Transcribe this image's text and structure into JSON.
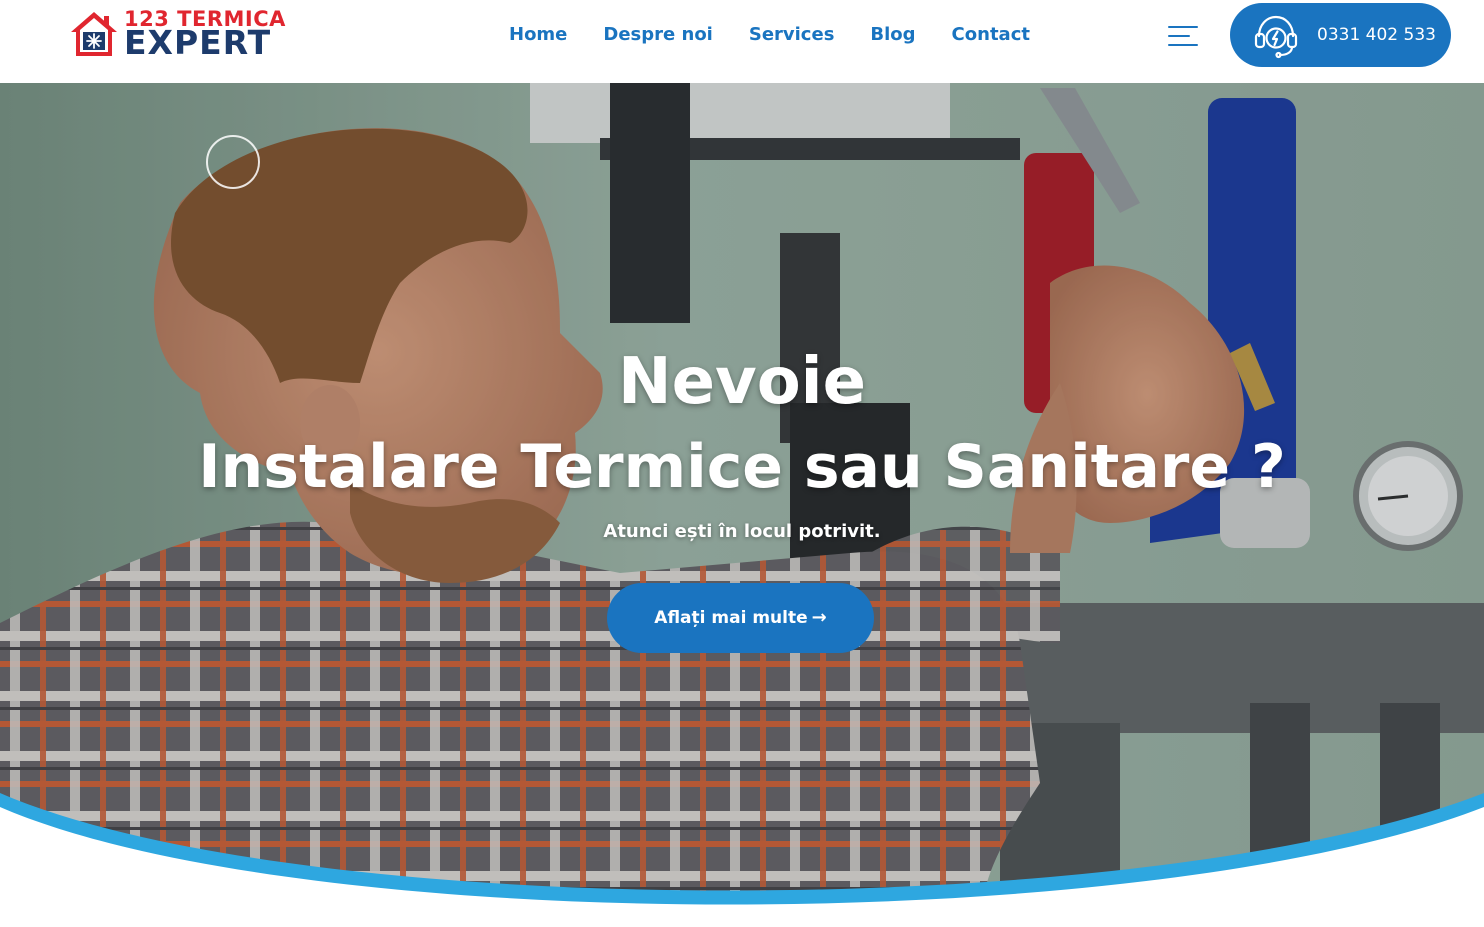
{
  "brand": {
    "line1": "123 TERMICA",
    "line2": "EXPERT",
    "colors": {
      "red": "#e0262f",
      "navy": "#1d3b6c",
      "accent": "#1a74c0"
    }
  },
  "nav": {
    "items": [
      {
        "label": "Home"
      },
      {
        "label": "Despre noi"
      },
      {
        "label": "Services"
      },
      {
        "label": "Blog"
      },
      {
        "label": "Contact"
      }
    ]
  },
  "header": {
    "menu_icon": "hamburger-menu-icon",
    "phone": {
      "icon": "headset-support-icon",
      "number": "0331 402 533"
    }
  },
  "hero": {
    "title_line1": "Nevoie",
    "title_line2": "Instalare Termice sau Sanitare ?",
    "subtitle": "Atunci ești în locul potrivit.",
    "cta_label": "Aflați mai multe",
    "cta_icon": "arrow-right-icon",
    "wave_color": "#2ea7e0"
  }
}
